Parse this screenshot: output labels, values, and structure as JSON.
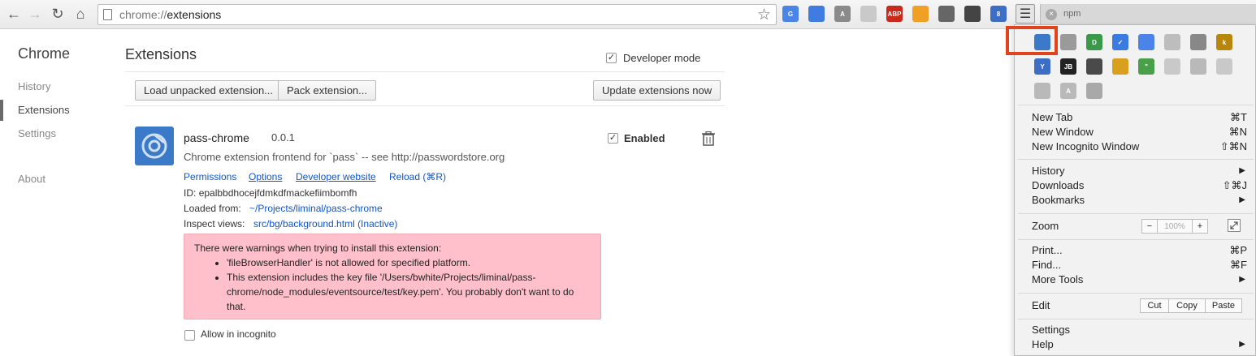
{
  "toolbar": {
    "url_scheme": "chrome://",
    "url_path": "extensions",
    "tab_title": "npm",
    "tab_close": "×",
    "toolbar_icons": [
      {
        "name": "translate-icon",
        "color": "#4a84e8",
        "text": "G"
      },
      {
        "name": "cast-icon",
        "color": "#3f7be0",
        "text": ""
      },
      {
        "name": "angular-icon",
        "color": "#8a8a8a",
        "text": "A"
      },
      {
        "name": "hexagon-icon",
        "color": "#c9c9c9",
        "text": ""
      },
      {
        "name": "adblock-plus-icon",
        "color": "#c8291c",
        "text": "ABP"
      },
      {
        "name": "analytics-icon",
        "color": "#f0a125",
        "text": ""
      },
      {
        "name": "ghostery-icon",
        "color": "#666666",
        "text": ""
      },
      {
        "name": "panda-icon",
        "color": "#444444",
        "text": ""
      },
      {
        "name": "people-icon",
        "color": "#3b6ec4",
        "text": "8"
      }
    ]
  },
  "sidebar": {
    "title": "Chrome",
    "items": [
      "History",
      "Extensions",
      "Settings",
      "About"
    ]
  },
  "main": {
    "title": "Extensions",
    "developer_mode_label": "Developer mode",
    "developer_mode_checked": true,
    "buttons": {
      "load_unpacked": "Load unpacked extension...",
      "pack": "Pack extension...",
      "update": "Update extensions now"
    }
  },
  "extension": {
    "name": "pass-chrome",
    "version": "0.0.1",
    "description": "Chrome extension frontend for `pass` -- see http://passwordstore.org",
    "enabled_label": "Enabled",
    "enabled": true,
    "links": [
      "Permissions",
      "Options",
      "Developer website",
      "Reload (⌘R)"
    ],
    "id_label": "ID:",
    "id_value": "epalbbdhocejfdmkdfmackefiimbomfh",
    "loaded_from_label": "Loaded from:",
    "loaded_from_value": "~/Projects/liminal/pass-chrome",
    "inspect_label": "Inspect views:",
    "inspect_value": "src/bg/background.html (Inactive)",
    "warning_title": "There were warnings when trying to install this extension:",
    "warnings": [
      "'fileBrowserHandler' is not allowed for specified platform.",
      "This extension includes the key file '/Users/bwhite/Projects/liminal/pass-chrome/node_modules/eventsource/test/key.pem'. You probably don't want to do that."
    ],
    "incognito_label": "Allow in incognito",
    "incognito_checked": false
  },
  "menu": {
    "extension_icons": [
      {
        "name": "pass-chrome-icon",
        "color": "#3b7ac8",
        "text": ""
      },
      {
        "name": "tux-icon",
        "color": "#9a9a9a",
        "text": ""
      },
      {
        "name": "green-d-icon",
        "color": "#3a9a4a",
        "text": "D"
      },
      {
        "name": "checkmark-icon",
        "color": "#3b7ae0",
        "text": "✓"
      },
      {
        "name": "tag-icon",
        "color": "#4a84e8",
        "text": ""
      },
      {
        "name": "leaf-icon",
        "color": "#bdbdbd",
        "text": ""
      },
      {
        "name": "plug-icon",
        "color": "#888888",
        "text": ""
      },
      {
        "name": "k-icon",
        "color": "#b8860b",
        "text": "k"
      },
      {
        "name": "y-icon",
        "color": "#3b6ec4",
        "text": "Y"
      },
      {
        "name": "jetbrains-icon",
        "color": "#222222",
        "text": "JB"
      },
      {
        "name": "portrait-icon",
        "color": "#4a4a4a",
        "text": ""
      },
      {
        "name": "color-grid-icon",
        "color": "#d9a020",
        "text": ""
      },
      {
        "name": "quote-icon",
        "color": "#4aa04a",
        "text": "\""
      },
      {
        "name": "swirl-icon",
        "color": "#c9c9c9",
        "text": ""
      },
      {
        "name": "dropbox-icon",
        "color": "#b9b9b9",
        "text": ""
      },
      {
        "name": "atom-icon",
        "color": "#c9c9c9",
        "text": ""
      },
      {
        "name": "rss-icon",
        "color": "#b9b9b9",
        "text": ""
      },
      {
        "name": "angular-gray-icon",
        "color": "#b9b9b9",
        "text": "A"
      },
      {
        "name": "drive-icon",
        "color": "#a9a9a9",
        "text": ""
      }
    ],
    "new_tab": "New Tab",
    "new_tab_sc": "⌘T",
    "new_window": "New Window",
    "new_window_sc": "⌘N",
    "new_incognito": "New Incognito Window",
    "new_incognito_sc": "⇧⌘N",
    "history": "History",
    "downloads": "Downloads",
    "downloads_sc": "⇧⌘J",
    "bookmarks": "Bookmarks",
    "zoom": "Zoom",
    "zoom_minus": "−",
    "zoom_value": "100%",
    "zoom_plus": "+",
    "print": "Print...",
    "print_sc": "⌘P",
    "find": "Find...",
    "find_sc": "⌘F",
    "more_tools": "More Tools",
    "edit": "Edit",
    "cut": "Cut",
    "copy": "Copy",
    "paste": "Paste",
    "settings": "Settings",
    "help": "Help",
    "submenu_arrow": "▶"
  },
  "colors": {
    "highlight": "#e0441c",
    "link": "#1155cc",
    "warning_bg": "#ffc0cb"
  }
}
